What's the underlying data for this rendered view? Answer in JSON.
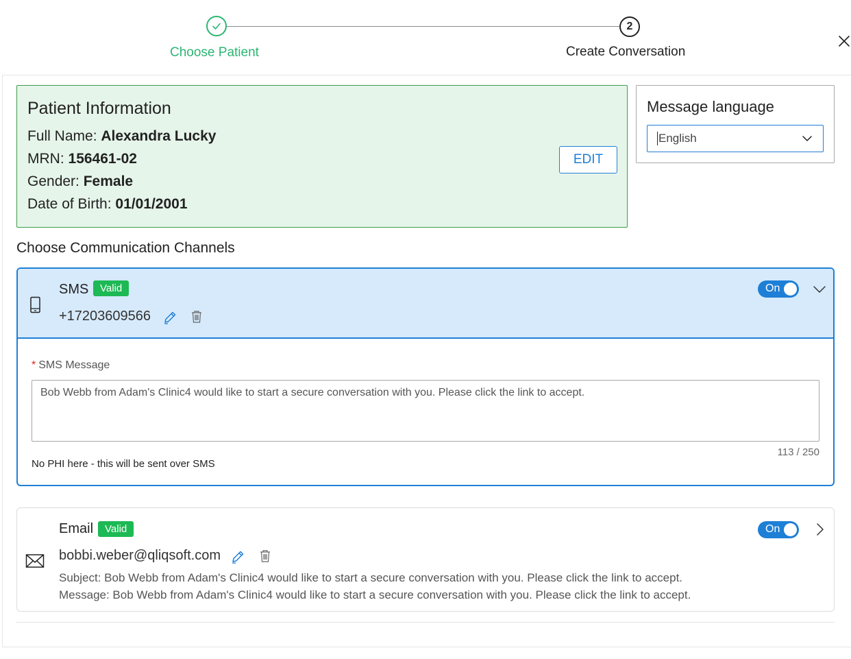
{
  "stepper": {
    "steps": [
      {
        "label": "Choose Patient",
        "state": "completed"
      },
      {
        "label": "Create Conversation",
        "number": "2",
        "state": "current"
      }
    ]
  },
  "patient": {
    "title": "Patient Information",
    "full_name_label": "Full Name:",
    "full_name": "Alexandra Lucky",
    "mrn_label": "MRN:",
    "mrn": "156461-02",
    "gender_label": "Gender:",
    "gender": "Female",
    "dob_label": "Date of Birth:",
    "dob": "01/01/2001",
    "edit_label": "EDIT"
  },
  "language": {
    "title": "Message language",
    "selected": "English"
  },
  "channels_title": "Choose Communication Channels",
  "sms": {
    "name": "SMS",
    "badge": "Valid",
    "phone": "+17203609566",
    "toggle_label": "On",
    "message_label": "SMS Message",
    "message": "Bob Webb from Adam's Clinic4 would like to start a secure conversation with you. Please click the link to accept.",
    "char_count": "113 / 250",
    "hint": "No PHI here - this will be sent over SMS"
  },
  "email": {
    "name": "Email",
    "badge": "Valid",
    "address": "bobbi.weber@qliqsoft.com",
    "toggle_label": "On",
    "subject_line": "Subject: Bob Webb from Adam's Clinic4 would like to start a secure conversation with you. Please click the link to accept.",
    "message_line": "Message: Bob Webb from Adam's Clinic4 would like to start a secure conversation with you. Please click the link to accept."
  },
  "colors": {
    "accent_blue": "#1e7fd6",
    "success_green": "#2bb673",
    "badge_green": "#1db954",
    "patient_bg": "#e6f5ea",
    "sms_header_bg": "#d6eafb"
  },
  "icons": [
    "check-icon",
    "close-icon",
    "chevron-down-icon",
    "mobile-phone-icon",
    "pencil-icon",
    "trash-icon",
    "chevron-right-icon",
    "envelope-icon"
  ]
}
